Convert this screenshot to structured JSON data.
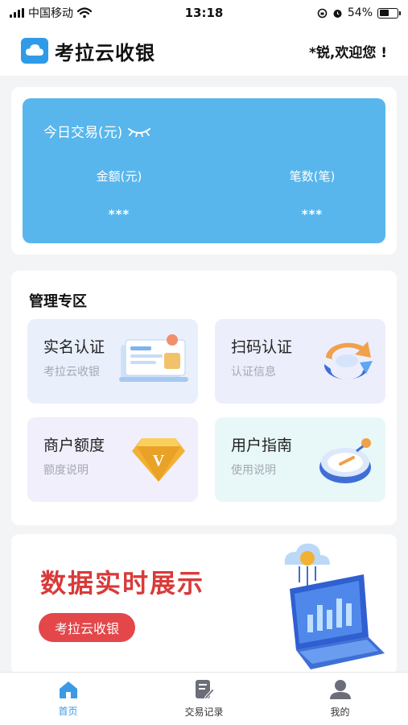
{
  "status_bar": {
    "carrier": "中国移动",
    "time": "13:18",
    "battery": "54%",
    "battery_level": 0.54
  },
  "header": {
    "app_title": "考拉云收银",
    "welcome": "*锐,欢迎您 !"
  },
  "today": {
    "title": "今日交易(元)",
    "amount_label": "金额(元)",
    "amount_value": "***",
    "count_label": "笔数(笔)",
    "count_value": "***"
  },
  "management": {
    "title": "管理专区",
    "tiles": [
      {
        "title": "实名认证",
        "subtitle": "考拉云收银"
      },
      {
        "title": "扫码认证",
        "subtitle": "认证信息"
      },
      {
        "title": "商户额度",
        "subtitle": "额度说明"
      },
      {
        "title": "用户指南",
        "subtitle": "使用说明"
      }
    ]
  },
  "banner": {
    "title": "数据实时展示",
    "button": "考拉云收银"
  },
  "tabbar": {
    "items": [
      {
        "label": "首页",
        "icon": "home-icon"
      },
      {
        "label": "交易记录",
        "icon": "document-edit-icon"
      },
      {
        "label": "我的",
        "icon": "user-icon"
      }
    ]
  },
  "colors": {
    "accent": "#58b6ec",
    "tab_active": "#3a9ae6",
    "banner_red": "#d93a3a",
    "tile_realname_bg": "#e9f0fb",
    "tile_scan_bg": "#eceefc",
    "tile_quota_bg": "#f0effb",
    "tile_guide_bg": "#e8f8f8"
  }
}
